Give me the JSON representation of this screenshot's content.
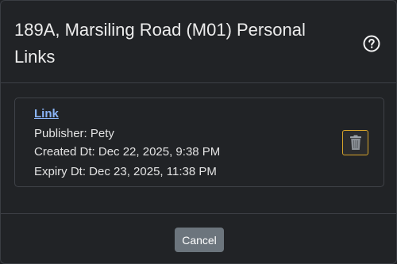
{
  "modal": {
    "title": "189A, Marsiling Road (M01) Personal Links",
    "help_icon": "question-circle-icon"
  },
  "link_card": {
    "link_label": "Link",
    "publisher": "Publisher: Pety",
    "created": "Created Dt: Dec 22, 2025, 9:38 PM",
    "expiry": "Expiry Dt: Dec 23, 2025, 11:38 PM",
    "delete_icon": "trash-icon"
  },
  "footer": {
    "cancel_label": "Cancel"
  },
  "colors": {
    "background": "#212326",
    "link": "#8ab4f8",
    "delete_border": "#d8a52b",
    "cancel_button": "#6c757d"
  }
}
